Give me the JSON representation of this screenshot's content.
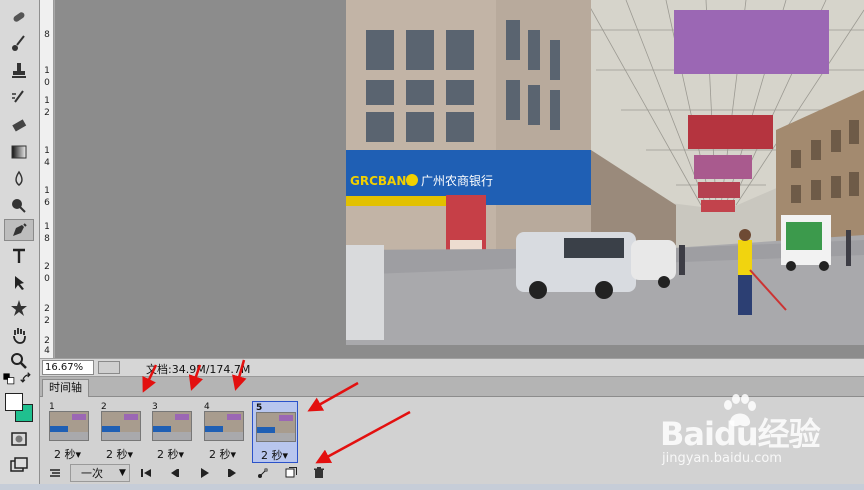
{
  "status": {
    "zoom": "16.67%",
    "doc_size": "文档:34.9M/174.7M"
  },
  "ruler": {
    "labels": [
      "8",
      "1",
      "0",
      "1",
      "2",
      "1",
      "4",
      "1",
      "6",
      "1",
      "8",
      "2",
      "0",
      "2",
      "2",
      "2",
      "4"
    ]
  },
  "timeline": {
    "tab_label": "时间轴",
    "frames": [
      {
        "number": "1",
        "delay": "2 秒▾"
      },
      {
        "number": "2",
        "delay": "2 秒▾"
      },
      {
        "number": "3",
        "delay": "2 秒▾"
      },
      {
        "number": "4",
        "delay": "2 秒▾"
      },
      {
        "number": "5",
        "delay": "2 秒▾"
      }
    ],
    "loop_option": "一次",
    "selected_frame": "5"
  },
  "photo": {
    "bank_sign_en": "GRCBANK",
    "bank_sign_cn": "广州农商银行"
  },
  "watermark": {
    "brand": "Baidu经验",
    "url": "jingyan.baidu.com"
  },
  "colors": {
    "foreground": "#ffffff",
    "background": "#1fc08f",
    "annotation_arrow": "#e3100f"
  }
}
